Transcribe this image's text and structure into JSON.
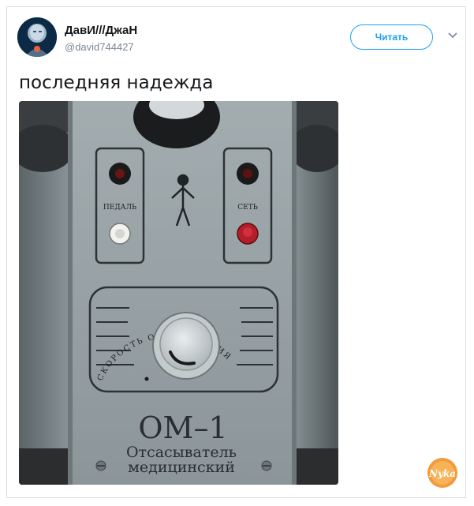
{
  "tweet": {
    "author": {
      "display_name": "ДавИ///ДжаН",
      "handle": "@david744427"
    },
    "follow_button_label": "Читать",
    "text": "последняя надежда"
  },
  "photo": {
    "panel_labels": {
      "left_socket": "ПЕДАЛЬ",
      "right_socket": "СЕТЬ"
    },
    "dial_label": "СКОРОСТЬ ОТСАСЫВАНИЯ",
    "device_model": "ОМ–1",
    "device_name_line1": "Отсасыватель",
    "device_name_line2": "медицинский"
  },
  "watermark": {
    "text": "Nyka"
  },
  "colors": {
    "accent": "#1da1f2",
    "text": "#14171a",
    "muted": "#7b8792"
  }
}
